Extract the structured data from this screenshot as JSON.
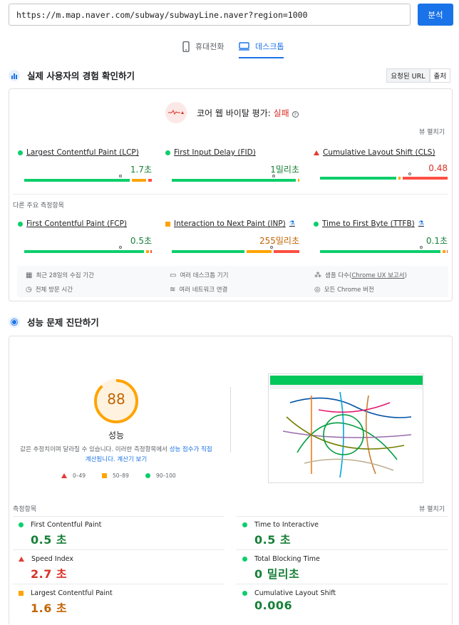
{
  "url_input": {
    "value": "https://m.map.naver.com/subway/subwayLine.naver?region=1000"
  },
  "analyze_button": "분석",
  "device_tabs": {
    "mobile": "휴대전화",
    "desktop": "데스크톱"
  },
  "crux": {
    "section_title": "실제 사용자의 경험 확인하기",
    "toggle": [
      "요청된 URL",
      "출처"
    ],
    "cwv_title": "코어 웹 바이탈 평가:",
    "cwv_result": "실패",
    "expand_label": "뷰 펼치기",
    "core_metrics": [
      {
        "name": "Largest Contentful Paint (LCP)",
        "value": "1.7초",
        "status": "good"
      },
      {
        "name": "First Input Delay (FID)",
        "value": "1밀리초",
        "status": "good"
      },
      {
        "name": "Cumulative Layout Shift (CLS)",
        "value": "0.48",
        "status": "poor"
      }
    ],
    "other_label": "다른 주요 측정항목",
    "other_metrics": [
      {
        "name": "First Contentful Paint (FCP)",
        "value": "0.5초",
        "status": "good"
      },
      {
        "name": "Interaction to Next Paint (INP)",
        "value": "255밀리초",
        "status": "needs-improvement"
      },
      {
        "name": "Time to First Byte (TTFB)",
        "value": "0.1초",
        "status": "good"
      }
    ],
    "info": {
      "collection": "최근 28일의 수집 기간",
      "devices": "여러 데스크톱 기기",
      "samples": "샘플 다수(",
      "samples_link": "Chrome UX 보고서",
      "samples_end": ")",
      "duration": "전체 방문 시간",
      "network": "여러 네트워크 연결",
      "versions": "모든 Chrome 버전"
    }
  },
  "lab": {
    "section_title": "성능 문제 진단하기",
    "score": "88",
    "score_value": 88,
    "score_label": "성능",
    "desc_a": "값은 추정치이며 달라질 수 있습니다. 이러한 측정항목에서 ",
    "desc_link1": "성능 점수가 직접 계산됩니다.",
    "desc_b": " ",
    "desc_link2": "계산기 보기",
    "legend": [
      "0–49",
      "50–89",
      "90–100"
    ],
    "metrics_label": "측정항목",
    "expand_label": "뷰 펼치기",
    "metrics": [
      {
        "name": "First Contentful Paint",
        "value": "0.5 초",
        "status": "good"
      },
      {
        "name": "Time to Interactive",
        "value": "0.5 초",
        "status": "good"
      },
      {
        "name": "Speed Index",
        "value": "2.7 초",
        "status": "poor"
      },
      {
        "name": "Total Blocking Time",
        "value": "0 밀리초",
        "status": "good"
      },
      {
        "name": "Largest Contentful Paint",
        "value": "1.6 초",
        "status": "average"
      },
      {
        "name": "Cumulative Layout Shift",
        "value": "0.006",
        "status": "good"
      }
    ]
  },
  "colors": {
    "good": "#0cce6b",
    "average": "#ffa400",
    "poor": "#ff4e42",
    "accent": "#1a73e8"
  }
}
